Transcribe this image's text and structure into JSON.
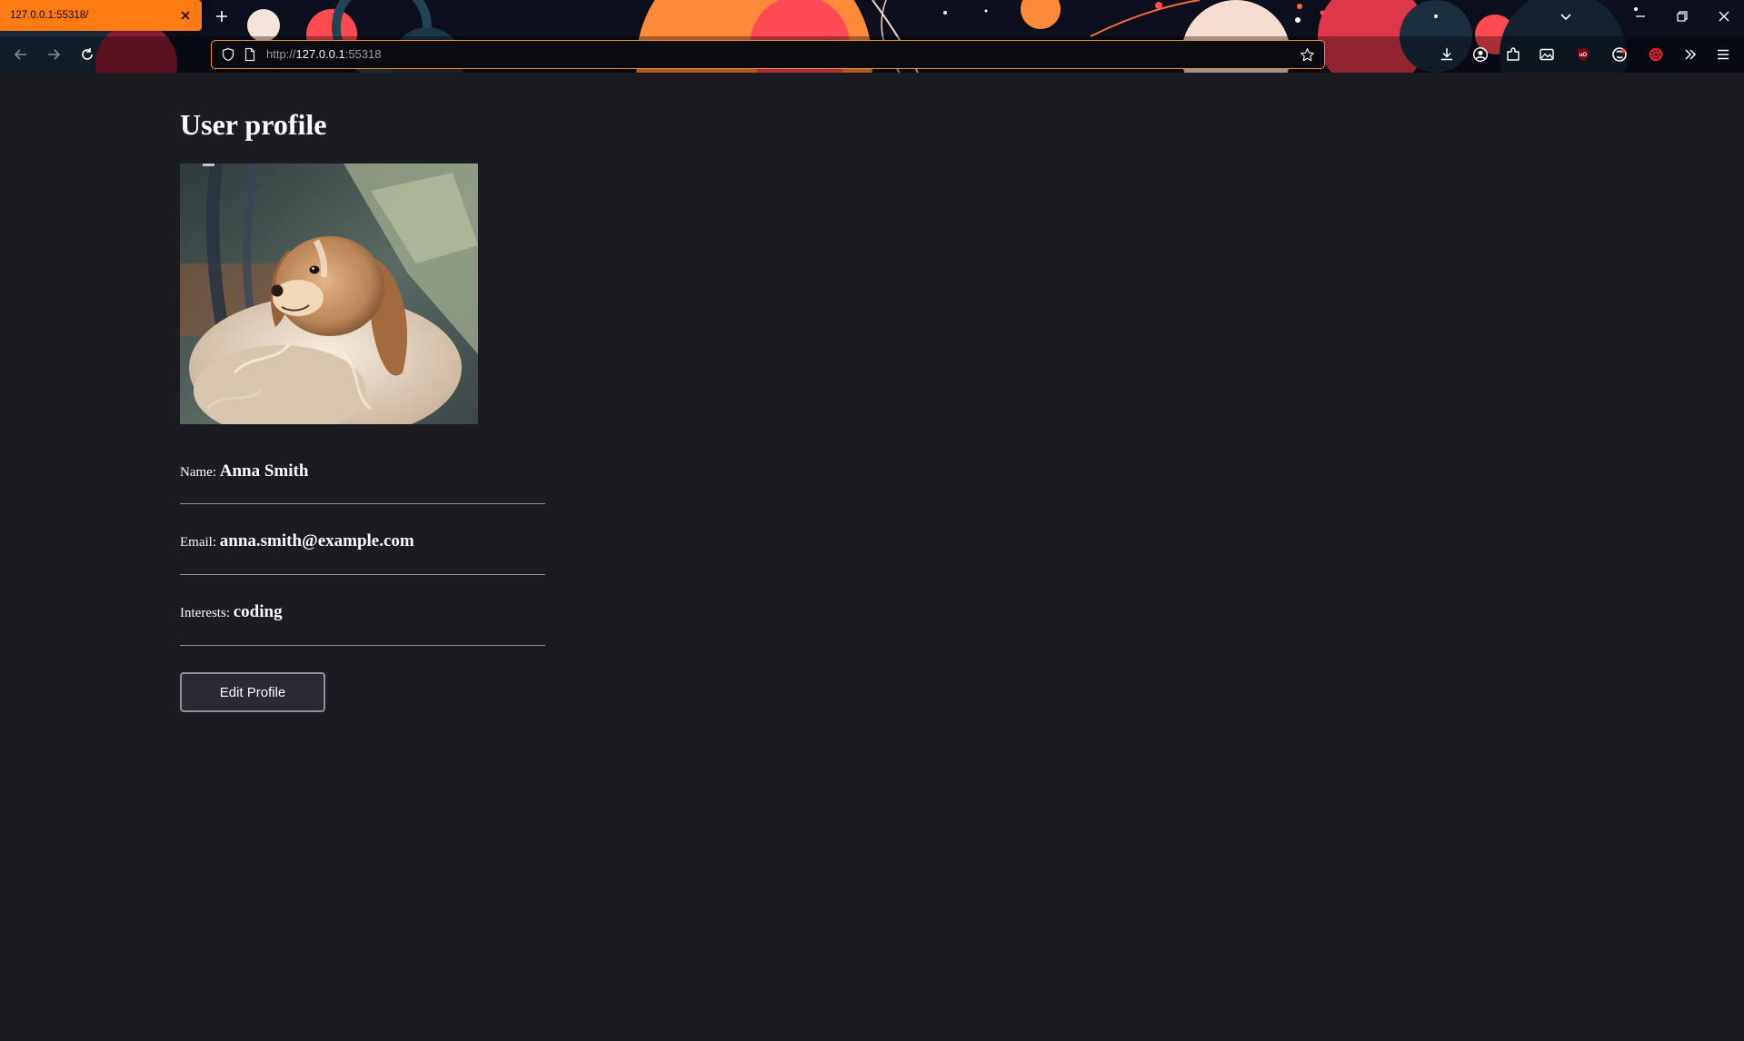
{
  "browser": {
    "tab": {
      "title": "127.0.0.1:55318/"
    },
    "url": {
      "scheme": "http://",
      "host": "127.0.0.1",
      "port": ":55318"
    },
    "accent": "#ff7a12"
  },
  "page": {
    "title": "User profile",
    "photo_icon": "profile-photo-dog",
    "fields": [
      {
        "label": "Name:",
        "value": "Anna Smith"
      },
      {
        "label": "Email:",
        "value": "anna.smith@example.com"
      },
      {
        "label": "Interests:",
        "value": "coding"
      }
    ],
    "edit_button_label": "Edit Profile"
  },
  "colors": {
    "page_bg": "#1c1b22",
    "text": "#fbfbfe",
    "divider": "#8f8f9d",
    "button_bg": "#2b2a33"
  }
}
